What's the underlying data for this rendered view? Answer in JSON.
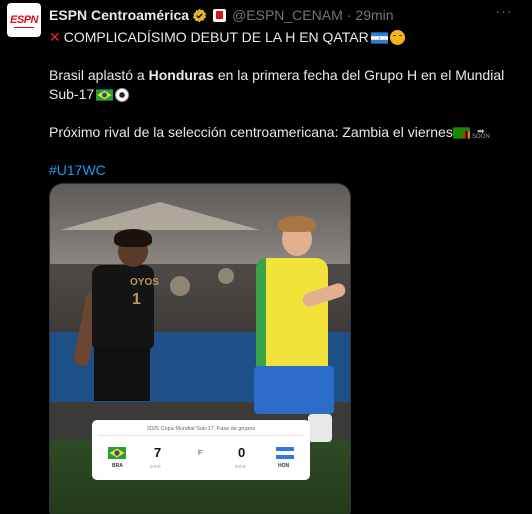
{
  "account": {
    "display_name": "ESPN Centroamérica",
    "handle": "@ESPN_CENAM",
    "separator": "·",
    "time": "29min",
    "avatar_text": "ESPN",
    "more_label": "···"
  },
  "tweet": {
    "line1": "COMPLICADÍSIMO DEBUT DE LA H EN QATAR",
    "line2_pre": "Brasil aplastó a ",
    "line2_bold": "Honduras",
    "line2_post": " en la primera fecha del Grupo H en el Mundial Sub-17",
    "line3": "Próximo rival de la selección centroamericana: Zambia el viernes",
    "soon_label": "SOON",
    "hashtag": "#U17WC"
  },
  "media": {
    "player_name": "OYOS",
    "player_number": "1",
    "scorecard": {
      "title": "2025 Copa Mundial Sub-17, Fase de grupos",
      "home_team": "BRA",
      "away_team": "HON",
      "home_score": "7",
      "away_score": "0",
      "status": "F",
      "home_detail": "0-0-0",
      "away_detail": "0-0-0"
    }
  },
  "colors": {
    "background": "#000000",
    "text": "#e7e9ea",
    "muted": "#71767b",
    "link": "#1d9bf0",
    "verified": "#e2b719",
    "espn_red": "#d7141a"
  },
  "icons": [
    "verified-icon",
    "x-mark-icon",
    "honduras-flag-icon",
    "worried-face-icon",
    "brazil-flag-icon",
    "soccer-ball-icon",
    "zambia-flag-icon",
    "soon-arrow-icon",
    "more-icon"
  ]
}
